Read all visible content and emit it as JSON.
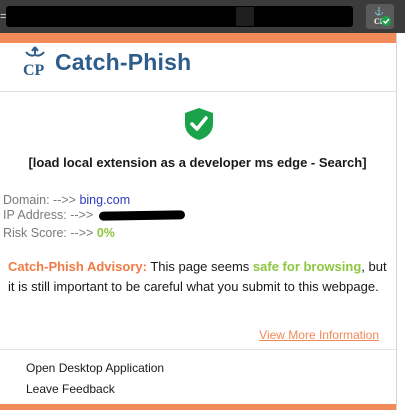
{
  "browser": {
    "tab_edge": "="
  },
  "header": {
    "title": "Catch-Phish",
    "logo_text": "CP"
  },
  "page": {
    "title": "[load local extension as a developer ms edge - Search]"
  },
  "details": {
    "domain_label": "Domain:",
    "domain_value": "bing.com",
    "ip_label": "IP Address:",
    "risk_label": "Risk Score:",
    "risk_value": "0%",
    "arrow": "-->>"
  },
  "advisory": {
    "label": "Catch-Phish Advisory:",
    "text_before": " This page seems ",
    "safe_text": "safe for browsing",
    "text_after": ", but it is still important to be careful what you submit to this webpage."
  },
  "links": {
    "view_more": "View More Information"
  },
  "menu": {
    "open_app": "Open Desktop Application",
    "feedback": "Leave Feedback"
  },
  "colors": {
    "accent": "#f28b5a",
    "brand": "#2d5d8a",
    "safe": "#8dc63f",
    "shield": "#1aa34a"
  },
  "icons": [
    "extension-icon",
    "catch-phish-logo",
    "shield-check-icon"
  ]
}
